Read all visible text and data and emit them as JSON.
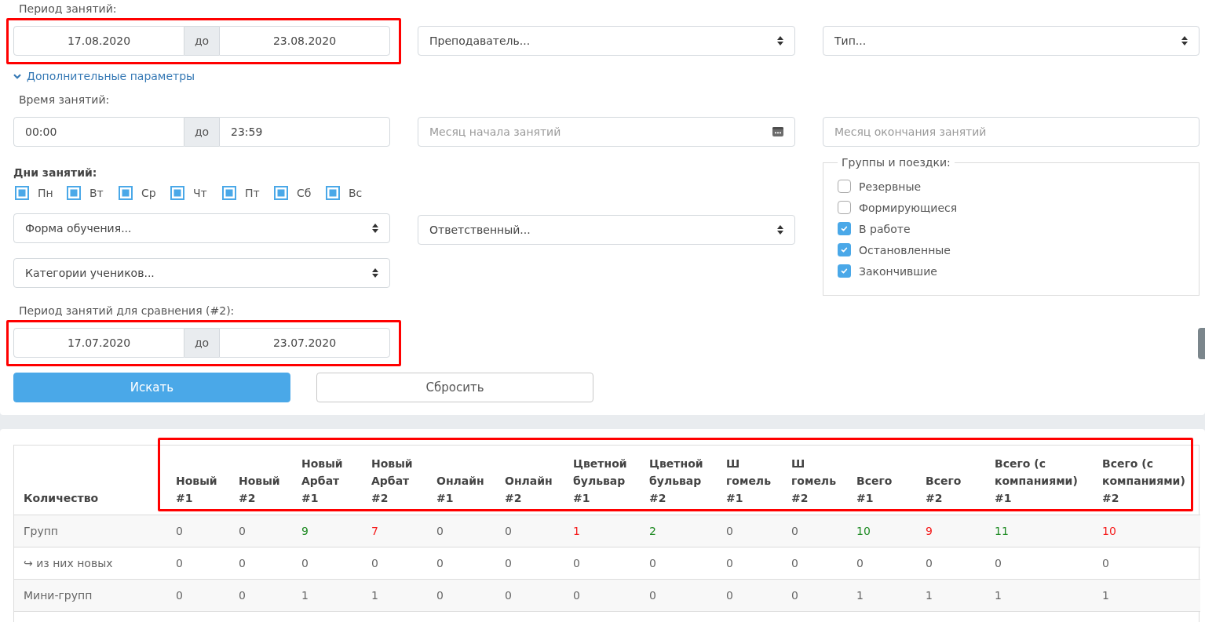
{
  "filters": {
    "period": {
      "label": "Период занятий:",
      "kind": "date",
      "from": "17.08.2020",
      "separator": "до",
      "to": "23.08.2020",
      "highlighted": true
    },
    "teacher": {
      "value": "Преподаватель..."
    },
    "type": {
      "value": "Тип..."
    },
    "more_options": {
      "label": "Дополнительные параметры",
      "expanded": true
    },
    "time": {
      "label": "Время занятий:",
      "kind": "time",
      "from": "00:00",
      "separator": "до",
      "to": "23:59"
    },
    "month_start": {
      "placeholder": "Месяц начала занятий"
    },
    "month_end": {
      "placeholder": "Месяц окончания занятий"
    },
    "days": {
      "label": "Дни занятий:",
      "items": [
        {
          "label": "Пн",
          "checked": true
        },
        {
          "label": "Вт",
          "checked": true
        },
        {
          "label": "Ср",
          "checked": true
        },
        {
          "label": "Чт",
          "checked": true
        },
        {
          "label": "Пт",
          "checked": true
        },
        {
          "label": "Сб",
          "checked": true
        },
        {
          "label": "Вс",
          "checked": true
        }
      ]
    },
    "groups": {
      "legend": "Группы и поездки:",
      "items": [
        {
          "label": "Резервные",
          "checked": false
        },
        {
          "label": "Формирующиеся",
          "checked": false
        },
        {
          "label": "В работе",
          "checked": true
        },
        {
          "label": "Остановленные",
          "checked": true
        },
        {
          "label": "Закончившие",
          "checked": true
        }
      ]
    },
    "study_form": {
      "value": "Форма обучения..."
    },
    "responsible": {
      "value": "Ответственный..."
    },
    "student_categories": {
      "value": "Категории учеников..."
    },
    "compare_period": {
      "label": "Период занятий для сравнения (#2):",
      "kind": "date",
      "from": "17.07.2020",
      "separator": "до",
      "to": "23.07.2020",
      "highlighted": true
    },
    "buttons": [
      {
        "label": "Искать",
        "kind": "primary"
      },
      {
        "label": "Сбросить",
        "kind": "secondary"
      }
    ]
  },
  "table": {
    "header_highlighted": true,
    "columns": [
      "Количество",
      "Новый #1",
      "Новый #2",
      "Новый Арбат #1",
      "Новый Арбат #2",
      "Онлайн #1",
      "Онлайн #2",
      "Цветной бульвар #1",
      "Цветной бульвар #2",
      "Ш гомель #1",
      "Ш гомель #2",
      "Всего #1",
      "Всего #2",
      "Всего (с компаниями) #1",
      "Всего (с компаниями) #2"
    ],
    "rows": [
      {
        "cells": [
          {
            "text": "Групп"
          },
          {
            "text": "0"
          },
          {
            "text": "0"
          },
          {
            "text": "9",
            "color": "#1f8b24"
          },
          {
            "text": "7",
            "color": "#f51b1b"
          },
          {
            "text": "0"
          },
          {
            "text": "0"
          },
          {
            "text": "1",
            "color": "#f51b1b"
          },
          {
            "text": "2",
            "color": "#1f8b24"
          },
          {
            "text": "0"
          },
          {
            "text": "0"
          },
          {
            "text": "10",
            "color": "#1f8b24"
          },
          {
            "text": "9",
            "color": "#f51b1b"
          },
          {
            "text": "11",
            "color": "#1f8b24"
          },
          {
            "text": "10",
            "color": "#f51b1b"
          }
        ]
      },
      {
        "cells": [
          {
            "text": "↪ из них новых"
          },
          {
            "text": "0"
          },
          {
            "text": "0"
          },
          {
            "text": "0"
          },
          {
            "text": "0"
          },
          {
            "text": "0"
          },
          {
            "text": "0"
          },
          {
            "text": "0"
          },
          {
            "text": "0"
          },
          {
            "text": "0"
          },
          {
            "text": "0"
          },
          {
            "text": "0"
          },
          {
            "text": "0"
          },
          {
            "text": "0"
          },
          {
            "text": "0"
          }
        ]
      },
      {
        "cells": [
          {
            "text": "Мини-групп"
          },
          {
            "text": "0"
          },
          {
            "text": "0"
          },
          {
            "text": "1"
          },
          {
            "text": "1"
          },
          {
            "text": "0"
          },
          {
            "text": "0"
          },
          {
            "text": "0"
          },
          {
            "text": "0"
          },
          {
            "text": "0"
          },
          {
            "text": "0"
          },
          {
            "text": "1"
          },
          {
            "text": "1"
          },
          {
            "text": "1"
          },
          {
            "text": "1"
          }
        ]
      }
    ]
  }
}
